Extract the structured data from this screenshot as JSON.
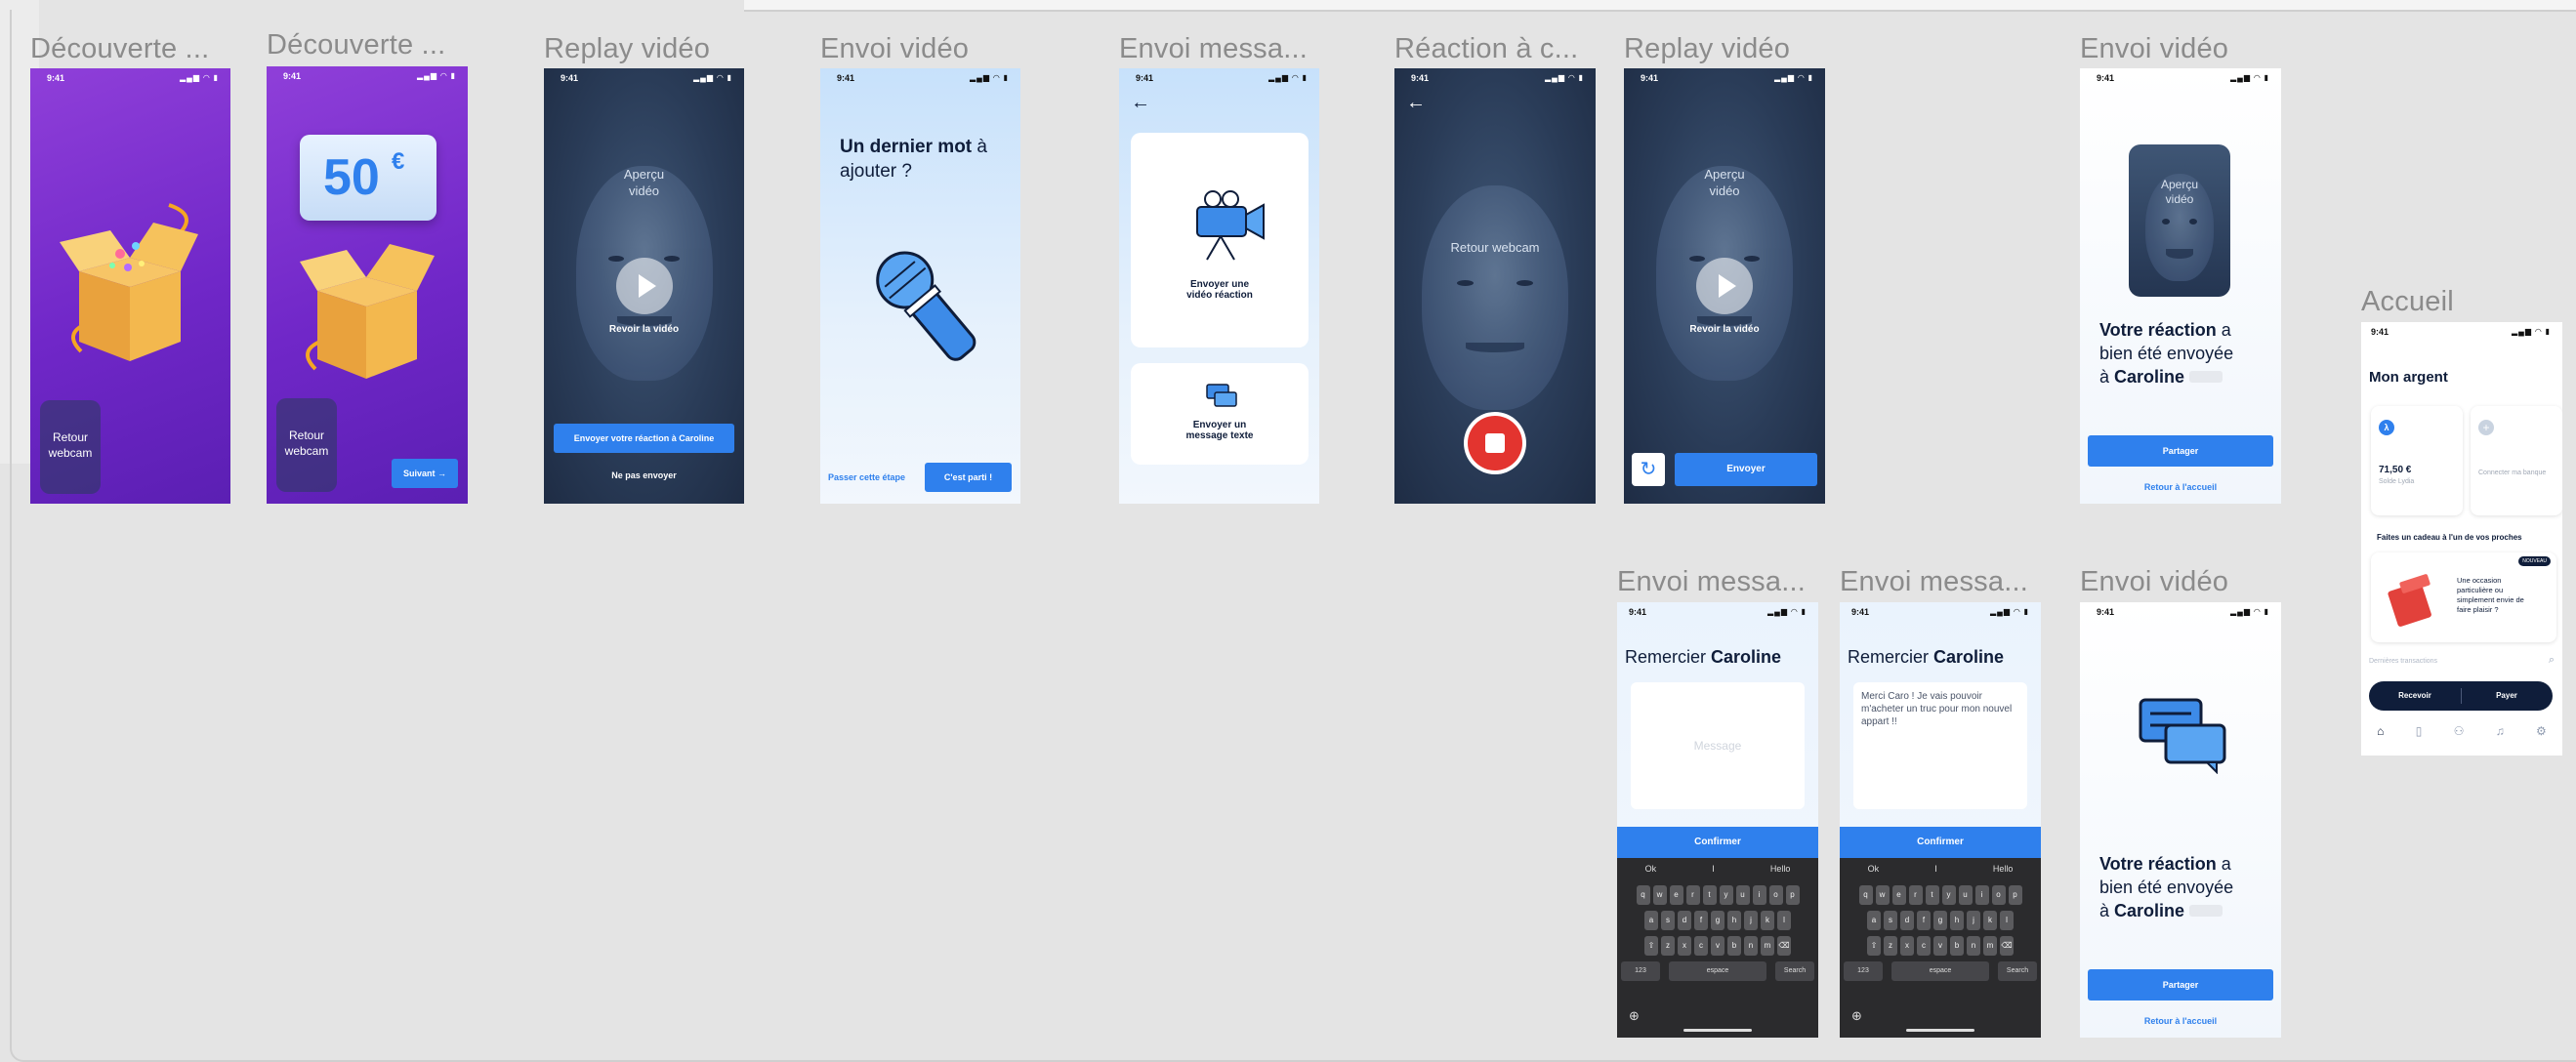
{
  "canvas": {
    "bg": "#e4e4e4",
    "accent": "#2f80ed",
    "navy": "#0f1d3a"
  },
  "status_time": "9:41",
  "status_icons": "▂▄▆ ◠ ▮",
  "labels": {
    "f1": "Découverte ...",
    "f2": "Découverte ...",
    "f3": "Replay vidéo",
    "f4": "Envoi vidéo",
    "f5": "Envoi messa...",
    "f6": "Réaction à c...",
    "f7": "Replay vidéo",
    "f8": "Envoi vidéo",
    "f9": "Accueil",
    "f10": "Envoi messa...",
    "f11": "Envoi messa...",
    "f12": "Envoi vidéo"
  },
  "decouverte1": {
    "webcam": "Retour webcam"
  },
  "decouverte2": {
    "amount": "50",
    "currency": "€",
    "webcam": "Retour webcam",
    "next": "Suivant →"
  },
  "replay1": {
    "preview": "Aperçu vidéo",
    "play_label": "Revoir la vidéo",
    "send": "Envoyer votre réaction à Caroline",
    "skip": "Ne pas envoyer"
  },
  "envoi1": {
    "title_bold": "Un dernier mot",
    "title_rest": " à ajouter ?",
    "skip": "Passer cette étape",
    "go": "C'est parti !"
  },
  "message_choice": {
    "card1": "Envoyer une vidéo réaction",
    "card2": "Envoyer un message texte"
  },
  "reaction": {
    "webcam": "Retour webcam"
  },
  "replay2": {
    "preview": "Aperçu vidéo",
    "play_label": "Revoir la vidéo",
    "send": "Envoyer"
  },
  "sent1": {
    "preview": "Aperçu vidéo",
    "l1_bold": "Votre réaction",
    "l1_rest": " a",
    "l2": "bien été envoyée",
    "l3_pre": "à ",
    "l3_bold": "Caroline",
    "share": "Partager",
    "back": "Retour à l'accueil"
  },
  "accueil": {
    "title": "Mon argent",
    "balance": "71,50 €",
    "balance_label": "Solde Lydia",
    "connect": "Connecter ma banque",
    "gift_title": "Faites un cadeau à l'un de vos proches",
    "badge": "NOUVEAU",
    "gift_text": "Une occasion particulière ou simplement envie de faire plaisir ?",
    "transactions": "Dernières transactions",
    "receive": "Recevoir",
    "pay": "Payer"
  },
  "msg_empty": {
    "title_pre": "Remercier ",
    "title_bold": "Caroline",
    "placeholder": "Message",
    "confirm": "Confirmer"
  },
  "msg_filled": {
    "title_pre": "Remercier ",
    "title_bold": "Caroline",
    "text": "Merci Caro ! Je vais pouvoir m'acheter un truc pour mon nouvel appart !!",
    "confirm": "Confirmer"
  },
  "keyboard": {
    "suggestions": [
      "Ok",
      "I",
      "Hello"
    ],
    "row1": [
      "q",
      "w",
      "e",
      "r",
      "t",
      "y",
      "u",
      "i",
      "o",
      "p"
    ],
    "row2": [
      "a",
      "s",
      "d",
      "f",
      "g",
      "h",
      "j",
      "k",
      "l"
    ],
    "row3": [
      "⇧",
      "z",
      "x",
      "c",
      "v",
      "b",
      "n",
      "m",
      "⌫"
    ],
    "num": "123",
    "space": "espace",
    "search": "Search"
  },
  "sent2": {
    "l1_bold": "Votre réaction",
    "l1_rest": " a",
    "l2": "bien été envoyée",
    "l3_pre": "à ",
    "l3_bold": "Caroline",
    "share": "Partager",
    "back": "Retour à l'accueil"
  }
}
